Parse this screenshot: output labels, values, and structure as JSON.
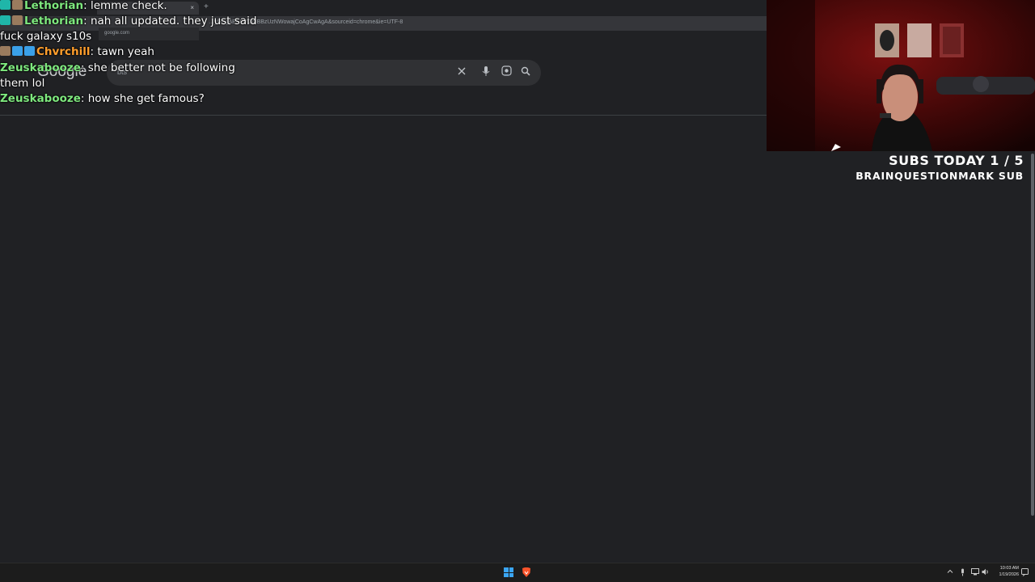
{
  "browser": {
    "tab_title": "",
    "tab_close": "×",
    "new_tab": "+",
    "url": "…ylBggAEEUYOdIBBzUzNWowajCoAgCwAgA&sourceid=chrome&ie=UTF-8",
    "omnibox_suggestion": "google.com"
  },
  "google": {
    "logo": "Google",
    "query": "bts",
    "icons": {
      "clear": "close-icon",
      "mic": "microphone-icon",
      "lens": "lens-icon",
      "search": "search-icon"
    }
  },
  "chat": {
    "messages": [
      {
        "user": "Lethorian",
        "user_color": "#7ee87e",
        "text": ": lemme check."
      },
      {
        "user": "Lethorian",
        "user_color": "#7ee87e",
        "text": ": nah all updated. they just said fuck galaxy s10s"
      },
      {
        "user": "Chvrchill",
        "user_color": "#ff9e2c",
        "text": ": tawn yeah"
      },
      {
        "user": "Zeuskabooze",
        "user_color": "#7ee87e",
        "text": ": she better not be following them lol"
      },
      {
        "user": "Zeuskabooze",
        "user_color": "#7ee87e",
        "text": ": how she get famous?"
      }
    ]
  },
  "stream": {
    "subs_count": "SUBS TODAY 1 / 5",
    "last_sub": "BRAINQUESTIONMARK SUB"
  },
  "taskbar": {
    "time": "10:03 AM",
    "date": "1/19/2026",
    "tray_icons": [
      "chevron-up-icon",
      "microphone-icon",
      "network-icon",
      "volume-icon",
      "notification-icon"
    ]
  },
  "colors": {
    "background": "#202124",
    "searchbox": "#303134",
    "start_blue": "#3aa5f3",
    "brave_orange": "#fb542b"
  }
}
